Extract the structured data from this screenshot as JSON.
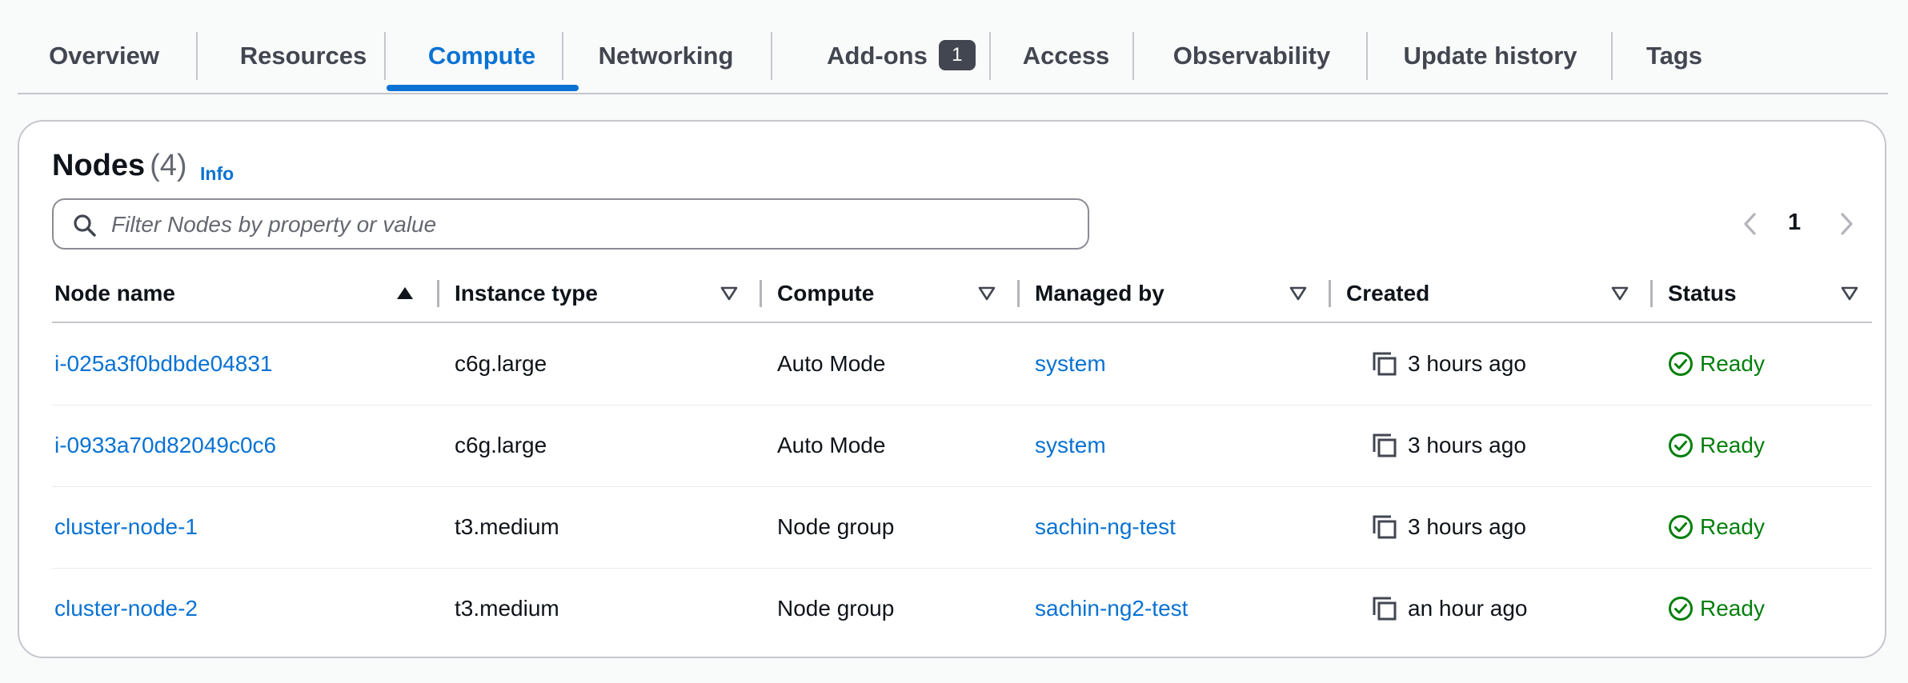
{
  "tabs": [
    {
      "label": "Overview"
    },
    {
      "label": "Resources"
    },
    {
      "label": "Compute",
      "active": true
    },
    {
      "label": "Networking"
    },
    {
      "label": "Add-ons",
      "badge": "1"
    },
    {
      "label": "Access"
    },
    {
      "label": "Observability"
    },
    {
      "label": "Update history"
    },
    {
      "label": "Tags"
    }
  ],
  "nodes": {
    "title": "Nodes",
    "count": "(4)",
    "info_label": "Info",
    "filter_placeholder": "Filter Nodes by property or value",
    "pagination": {
      "current_page": "1"
    },
    "columns": [
      "Node name",
      "Instance type",
      "Compute",
      "Managed by",
      "Created",
      "Status"
    ],
    "sort": {
      "column": "Node name",
      "direction": "ascending"
    },
    "rows": [
      {
        "name": "i-025a3f0bdbde04831",
        "instance_type": "c6g.large",
        "compute": "Auto Mode",
        "managed_by": "system",
        "created": "3 hours ago",
        "status": "Ready"
      },
      {
        "name": "i-0933a70d82049c0c6",
        "instance_type": "c6g.large",
        "compute": "Auto Mode",
        "managed_by": "system",
        "created": "3 hours ago",
        "status": "Ready"
      },
      {
        "name": "cluster-node-1",
        "instance_type": "t3.medium",
        "compute": "Node group",
        "managed_by": "sachin-ng-test",
        "created": "3 hours ago",
        "status": "Ready"
      },
      {
        "name": "cluster-node-2",
        "instance_type": "t3.medium",
        "compute": "Node group",
        "managed_by": "sachin-ng2-test",
        "created": "an hour ago",
        "status": "Ready"
      }
    ]
  },
  "colors": {
    "accent": "#0972d3",
    "success": "#037f0c",
    "text": "#0f141a",
    "muted": "#656871"
  },
  "icons": {
    "search": "search-icon",
    "copy": "copy-icon",
    "status_ready": "status-check-icon",
    "sort_asc": "sort-ascending-icon",
    "sort": "sort-icon",
    "prev": "chevron-left-icon",
    "next": "chevron-right-icon"
  }
}
